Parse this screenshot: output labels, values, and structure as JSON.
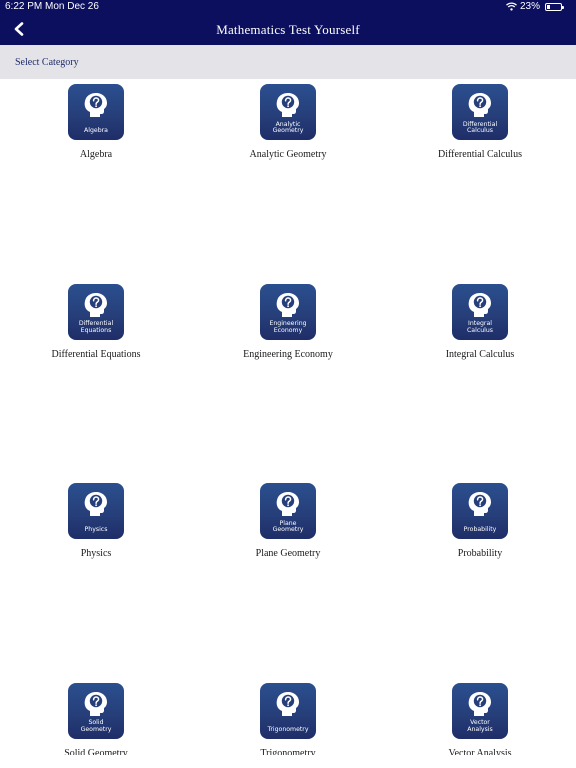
{
  "status": {
    "time": "6:22 PM",
    "date": "Mon Dec 26",
    "battery": "23%",
    "battery_level": 0.23
  },
  "header": {
    "title": "Mathematics Test Yourself",
    "back_icon": "chevron-left-icon"
  },
  "category_bar": {
    "label": "Select Category"
  },
  "categories": [
    {
      "tile": "Algebra",
      "name": "Algebra"
    },
    {
      "tile": "Analytic\nGeometry",
      "name": "Analytic Geometry"
    },
    {
      "tile": "Differential\nCalculus",
      "name": "Differential Calculus"
    },
    {
      "tile": "Differential\nEquations",
      "name": "Differential Equations"
    },
    {
      "tile": "Engineering\nEconomy",
      "name": "Engineering Economy"
    },
    {
      "tile": "Integral\nCalculus",
      "name": "Integral Calculus"
    },
    {
      "tile": "Physics",
      "name": "Physics"
    },
    {
      "tile": "Plane\nGeometry",
      "name": "Plane Geometry"
    },
    {
      "tile": "Probability",
      "name": "Probability"
    },
    {
      "tile": "Solid\nGeometry",
      "name": "Solid Geometry"
    },
    {
      "tile": "Trigonometry",
      "name": "Trigonometry"
    },
    {
      "tile": "Vector\nAnalysis",
      "name": "Vector Analysis"
    }
  ],
  "colors": {
    "nav_bg": "#0c0f5e",
    "tile_bg": "#263f7a",
    "category_bar_bg": "#e4e4e8"
  }
}
